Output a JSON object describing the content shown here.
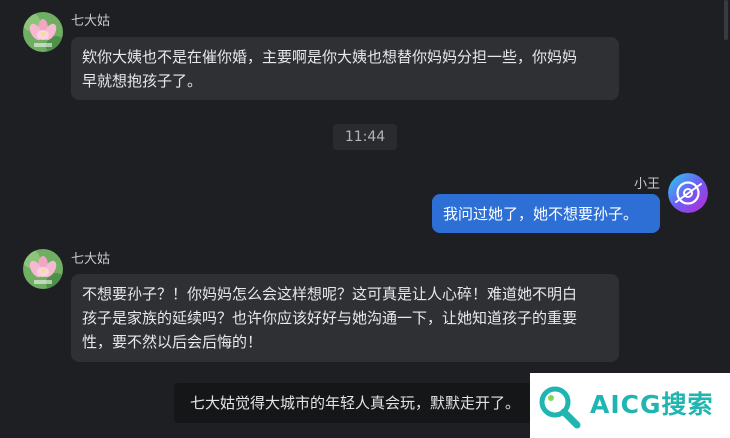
{
  "messages": [
    {
      "sender": "七大姑",
      "text_lines": [
        "欸你大姨也不是在催你婚，主要啊是你大姨也想替你妈妈分担一些，你妈妈",
        "早就想抱孩子了。"
      ]
    },
    {
      "sender": "小王",
      "text_lines": [
        "我问过她了，她不想要孙子。"
      ]
    },
    {
      "sender": "七大姑",
      "text_lines": [
        "不想要孙子？！你妈妈怎么会这样想呢？这可真是让人心碎！难道她不明白",
        "孩子是家族的延续吗？也许你应该好好与她沟通一下，让她知道孩子的重要",
        "性，要不然以后会后悔的！"
      ]
    }
  ],
  "timestamp": "11:44",
  "system_notice": "七大姑觉得大城市的年轻人真会玩，默默走开了。",
  "watermark": {
    "text": "AICG搜索"
  },
  "colors": {
    "background": "#1e1f22",
    "incoming_bubble": "#2f3034",
    "outgoing_bubble": "#2e6fd6",
    "watermark_accent": "#1fb5b0"
  },
  "icons": {
    "relative_avatar": "lotus-flower-avatar",
    "user_avatar": "gradient-logo-avatar",
    "watermark": "magnifier-icon"
  }
}
